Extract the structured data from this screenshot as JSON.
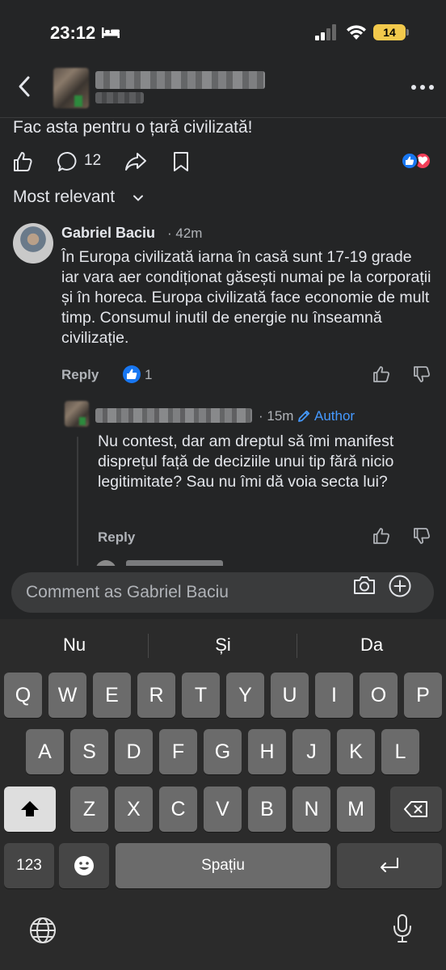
{
  "status_bar": {
    "time": "23:12",
    "battery": "14"
  },
  "post": {
    "text": "Fac asta pentru o țară civilizată!",
    "comment_count": "12"
  },
  "sort": {
    "label": "Most relevant"
  },
  "comment": {
    "author": "Gabriel Baciu",
    "time": "· 42m",
    "text": "În Europa civilizată iarna în casă sunt 17-19 grade iar vara aer condiționat găsești numai pe la corporații și în horeca. Europa civilizată face economie de mult timp. Consumul inutil de energie nu înseamnă civilizație.",
    "reply_label": "Reply",
    "like_count": "1"
  },
  "reply": {
    "time": "· 15m",
    "author_badge": "Author",
    "text": "Nu contest, dar am dreptul să îmi manifest disprețul față de deciziile unui tip fără nicio legitimitate? Sau nu îmi dă voia secta lui?",
    "reply_label": "Reply"
  },
  "composer": {
    "placeholder": "Comment as Gabriel Baciu"
  },
  "keyboard": {
    "suggestions": [
      "Nu",
      "Și",
      "Da"
    ],
    "row1": [
      "Q",
      "W",
      "E",
      "R",
      "T",
      "Y",
      "U",
      "I",
      "O",
      "P"
    ],
    "row2": [
      "A",
      "S",
      "D",
      "F",
      "G",
      "H",
      "J",
      "K",
      "L"
    ],
    "row3": [
      "Z",
      "X",
      "C",
      "V",
      "B",
      "N",
      "M"
    ],
    "numbers_label": "123",
    "space_label": "Spațiu"
  },
  "colors": {
    "accent": "#1877f2",
    "author_blue": "#4599ff",
    "love": "#f33e58"
  },
  "icons": [
    "bed-icon",
    "signal-icon",
    "wifi-icon",
    "back-arrow-icon",
    "more-icon",
    "like-icon",
    "comment-icon",
    "share-icon",
    "bookmark-icon",
    "chevron-down-icon",
    "thumb-up-icon",
    "thumb-down-icon",
    "pencil-icon",
    "camera-icon",
    "plus-icon",
    "shift-icon",
    "backspace-icon",
    "emoji-icon",
    "return-icon",
    "globe-icon",
    "mic-icon"
  ]
}
